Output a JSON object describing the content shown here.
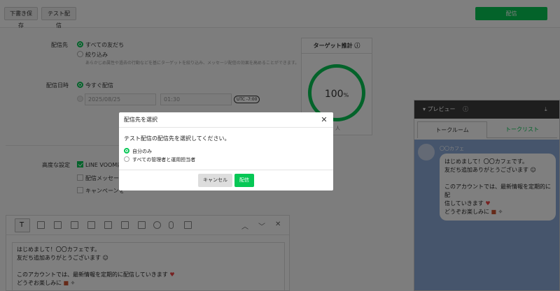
{
  "topbar": {
    "draft_label": "下書き保存",
    "test_label": "テスト配信",
    "send_label": "配信"
  },
  "form": {
    "recipients_label": "配信先",
    "recipients_all": "すべての友だち",
    "recipients_filter": "絞り込み",
    "recipients_note": "あらかじめ属性や過去の行動などを基にターゲットを絞り込み、メッセージ配信の効果を高めることができます。",
    "datetime_label": "配信日時",
    "send_now": "今すぐ配信",
    "date_value": "2025/08/25",
    "time_value": "01:30",
    "utc_badge": "UTC -7:00",
    "advanced_label": "高度な設定",
    "opt_voom": "LINE VOOMに",
    "opt_message": "配信メッセージ",
    "opt_campaign": "キャンペーンを"
  },
  "target": {
    "title": "ターゲット推計",
    "value": "100",
    "unit": "%",
    "partial": "人"
  },
  "editor": {
    "lines": [
      "はじめまして！〇〇カフェです。",
      "友だち追加ありがとうございます",
      "",
      "このアカウントでは、最新情報を定期的に配信していきます",
      "どうぞお楽しみに"
    ]
  },
  "preview": {
    "title": "プレビュー",
    "tab_talk": "トークルーム",
    "tab_list": "トークリスト",
    "account_name": "〇〇カフェ",
    "bubble_lines": [
      "はじめまして！〇〇カフェです。",
      "友だち追加ありがとうございます",
      "",
      "このアカウントでは、最新情報を定期的に配",
      "信していきます",
      "どうぞお楽しみに"
    ]
  },
  "modal": {
    "title": "配信先を選択",
    "description": "テスト配信の配信先を選択してください。",
    "option_self": "自分のみ",
    "option_all_admins": "すべての管理者と運用担当者",
    "cancel_label": "キャンセル",
    "send_label": "配信"
  },
  "colors": {
    "accent": "#06c755",
    "overlay": "#000000",
    "chat_bg": "#8dabd8",
    "preview_header": "#3c3c3c"
  }
}
